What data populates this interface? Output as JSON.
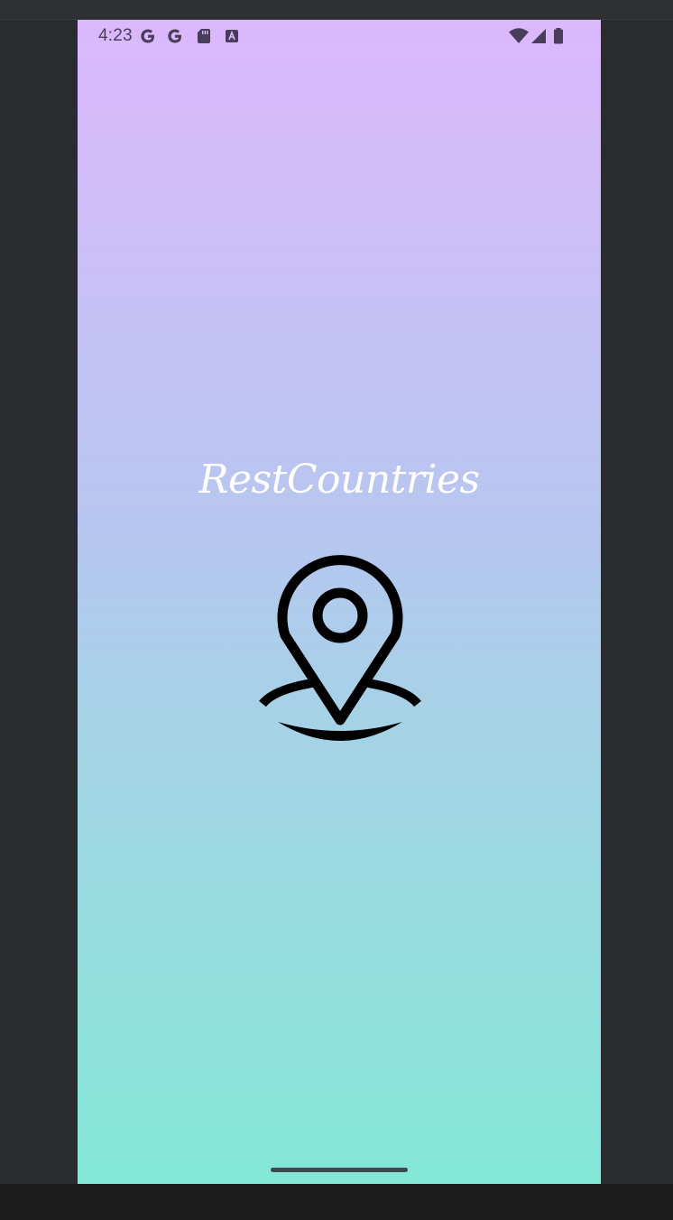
{
  "status_bar": {
    "time": "4:23",
    "left_icons": [
      "google-g-icon",
      "google-g-icon",
      "sd-card-icon",
      "font-a-icon"
    ],
    "right_icons": [
      "wifi-icon",
      "cellular-signal-icon",
      "battery-icon"
    ],
    "icon_color": "#4a3d5c"
  },
  "splash": {
    "app_name": "RestCountries",
    "logo_icon": "location-pin-icon"
  },
  "colors": {
    "gradient_top": "#dcb8fd",
    "gradient_bottom": "#83e7d6",
    "title_color": "#ffffff",
    "logo_color": "#000000"
  }
}
